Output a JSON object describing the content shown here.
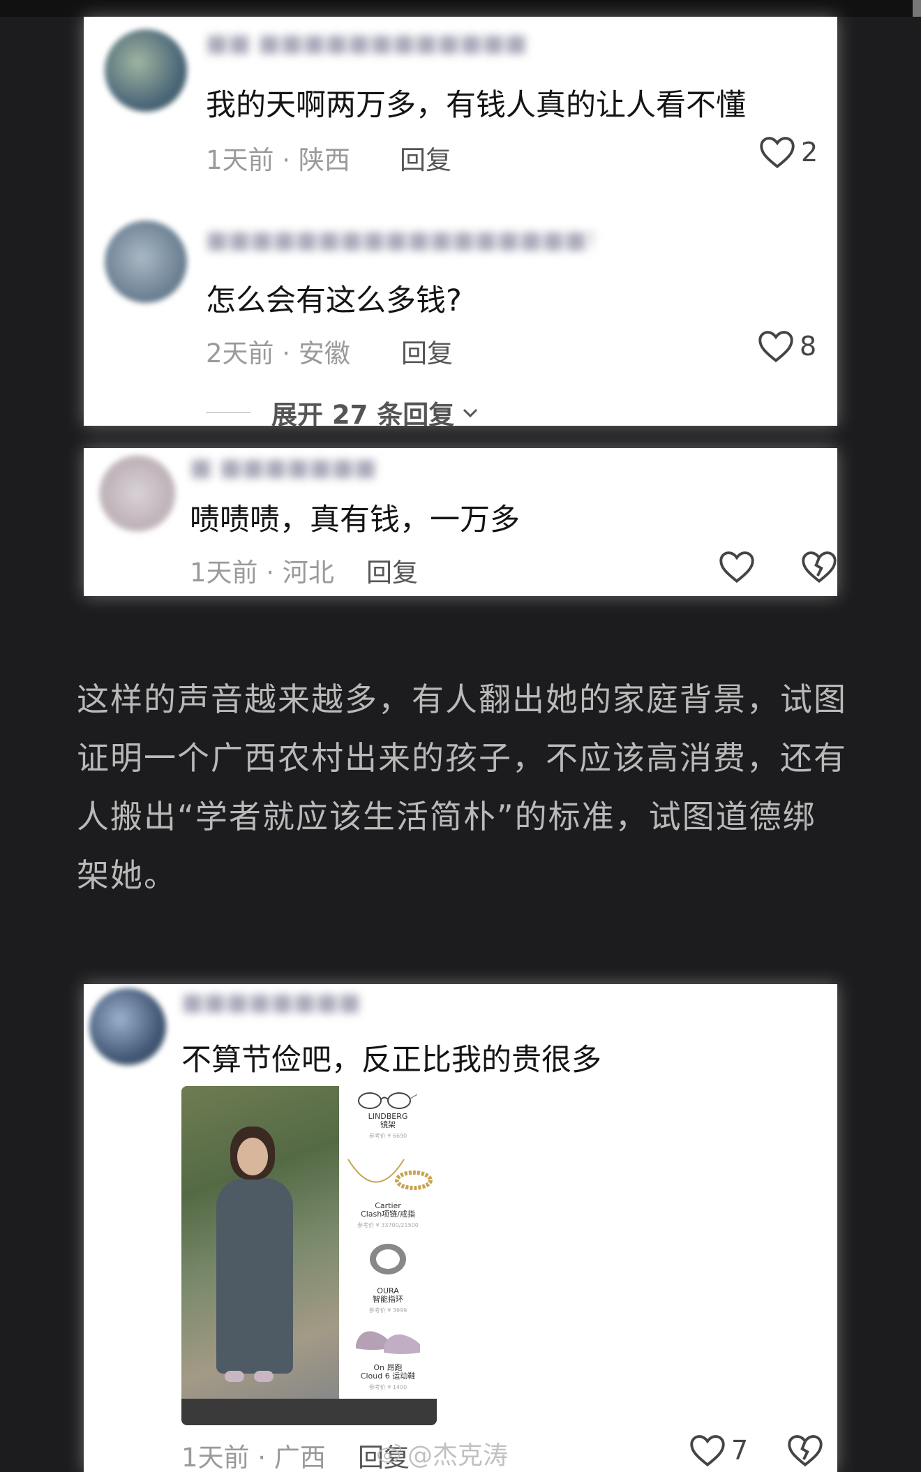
{
  "comments_top": [
    {
      "text": "我的天啊两万多，有钱人真的让人看不懂",
      "meta": "1天前 · 陕西",
      "reply": "回复",
      "likes": "2",
      "avatar_color": "#5f7b86"
    },
    {
      "text": "怎么会有这么多钱?",
      "meta": "2天前 · 安徽",
      "reply": "回复",
      "likes": "8",
      "avatar_color": "#7a8c9c"
    }
  ],
  "expand_replies": "展开 27 条回复",
  "comment_mid": {
    "text": "啧啧啧，真有钱，一万多",
    "meta": "1天前 · 河北",
    "reply": "回复",
    "avatar_color": "#c9c0c4"
  },
  "article_paragraph": "这样的声音越来越多，有人翻出她的家庭背景，试图证明一个广西农村出来的孩子，不应该高消费，还有人搬出“学者就应该生活简朴”的标准，试图道德绑架她。",
  "comment_bottom": {
    "text": "不算节俭吧，反正比我的贵很多",
    "meta": "1天前 · 广西",
    "reply": "回复",
    "likes": "7",
    "avatar_color": "#445a78",
    "products": [
      {
        "name": "LINDBERG\n镜架",
        "price": "参考价 ¥ 6690"
      },
      {
        "name": "Cartier\nClash项链/戒指",
        "price": "参考价 ¥ 33700/21500"
      },
      {
        "name": "OURA\n智能指环",
        "price": "参考价 ¥ 3999"
      },
      {
        "name": "On 昂跑\nCloud 6 运动鞋",
        "price": "参考价 ¥ 1400"
      }
    ]
  },
  "watermark": "@杰克涛",
  "colors": {
    "background": "#1c1c1e",
    "card": "#ffffff",
    "paragraph_text": "#b9b9b9"
  }
}
